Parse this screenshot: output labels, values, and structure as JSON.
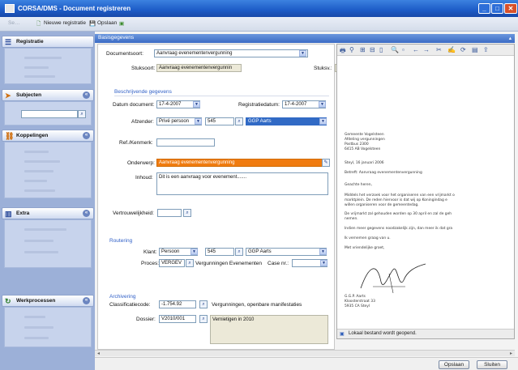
{
  "window": {
    "title": "CORSA/DMS - Document registreren"
  },
  "toolbar": {
    "disabled_item": "Se…",
    "new_label": "Nieuwe registratie",
    "save_label": "Opslaan"
  },
  "sidebar": {
    "registratie": "Registratie",
    "subjecten": "Subjecten",
    "koppelingen": "Koppelingen",
    "extra": "Extra",
    "werkprocessen": "Werkprocessen"
  },
  "panel": {
    "title": "Basisgegevens"
  },
  "form": {
    "documentsoort_label": "Documentsoort:",
    "documentsoort_value": "Aanvraag evenementenvergunning",
    "stuksoort_label": "Stuksoort:",
    "stuksoort_value": "Aanvraag evenementenvergunnin",
    "stuksv_label": "Stuksv.:",
    "beschrijvende_label": "Beschrijvende gegevens",
    "datum_document_label": "Datum document:",
    "datum_document_value": "17-4-2007",
    "registratiedatum_label": "Registratiedatum:",
    "registratiedatum_value": "17-4-2007",
    "afzender_label": "Afzender:",
    "afzender_type": "Privé persoon",
    "afzender_code": "545",
    "afzender_name": "GGP Aarts",
    "ref_label": "Ref./Kenmerk:",
    "ref_value": "",
    "onderwerp_label": "Onderwerp:",
    "onderwerp_value": "Aanvraag evenementenvergunning",
    "inhoud_label": "Inhoud:",
    "inhoud_value": "Dit is een aanvraag voor evenement.......",
    "vertrouwelijkheid_label": "Vertrouwelijkheid:",
    "routering_label": "Routering",
    "klant_label": "Klant:",
    "klant_type": "Persoon",
    "klant_code": "545",
    "klant_name": "GGP Aarts",
    "proces_label": "Proces:",
    "proces_code": "VERGEV",
    "proces_name": "Vergunningen Evenementen",
    "case_label": "Case nr.:",
    "archivering_label": "Archivering",
    "classificatiecode_label": "Classificatiecode:",
    "classificatiecode_value": "-1.754.92",
    "classificatie_desc": "Vergunningen, openbare manifestaties",
    "dossier_label": "Dossier:",
    "dossier_value": "V2010/001",
    "dossier_desc": "Vernietigen in 2010"
  },
  "preview": {
    "lines": [
      "Gemeente Vogelsteen",
      "Afdeling vergunningen",
      "Postbus 2300",
      "6415 AB Vogelsteen",
      "Steyl, 16 januari 2006",
      "Betreft: Aanvraag evenementenvergunning",
      "Geachte heren,",
      "Middels het verzoek voor het organiseren van een vrijmarkt o",
      "marktplein. De reden hiervoor is dat wij op Koningindag e",
      "willen organiseren voor de gemeentedag.",
      "De vrijmarkt zal gehouden worden op 30 april en zal de geh",
      "nemen.",
      "Indien meer gegevens noodzakelijk zijn, dan meer ik dat gra",
      "Ik vernemen graag van u.",
      "Met vriendelijke groet,",
      "G.G.P. Aarts",
      "Kloosterstraat 33",
      "5935 CA Steyl"
    ],
    "status": "Lokaal bestand wordt geopend."
  },
  "buttons": {
    "save": "Opslaan",
    "close": "Sluiten"
  },
  "colors": {
    "titlebar": "#1d5bc7",
    "onderwerp_bg": "#f07c10",
    "selection": "#316ac5",
    "sidebar_bg": "#9cb0d8"
  }
}
